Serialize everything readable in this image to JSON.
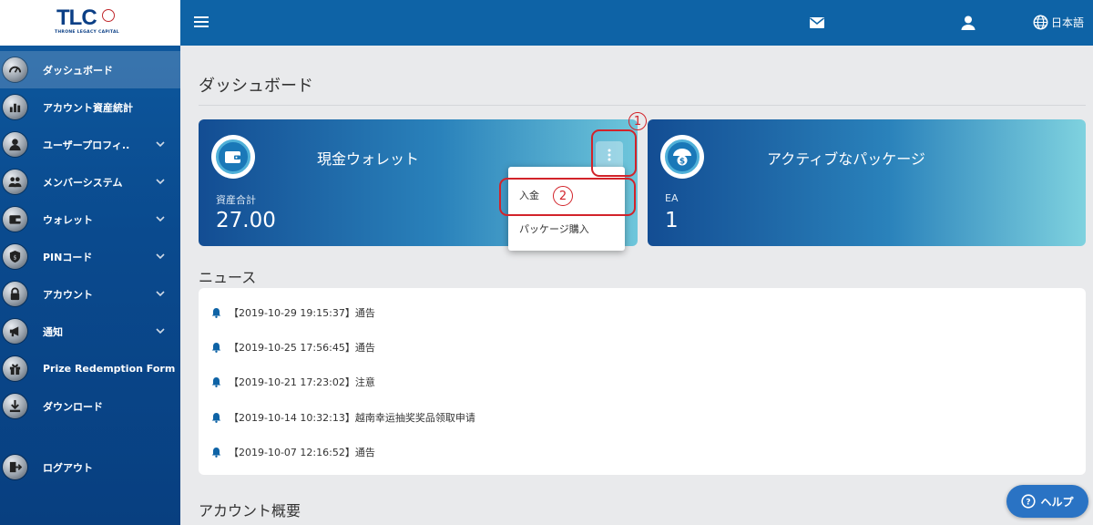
{
  "logo": {
    "text": "TLC",
    "sub": "THRONE LEGACY CAPITAL"
  },
  "sidebar": {
    "items": [
      {
        "label": "ダッシュボード",
        "icon": "dashboard-gauge-icon",
        "chevron": false
      },
      {
        "label": "アカウント資産統計",
        "icon": "bar-chart-icon",
        "chevron": false
      },
      {
        "label": "ユーザープロフィ..",
        "icon": "user-icon",
        "chevron": true
      },
      {
        "label": "メンバーシステム",
        "icon": "group-icon",
        "chevron": true
      },
      {
        "label": "ウォレット",
        "icon": "wallet-icon",
        "chevron": true
      },
      {
        "label": "PINコード",
        "icon": "pin-badge-icon",
        "chevron": true
      },
      {
        "label": "アカウント",
        "icon": "lock-icon",
        "chevron": true
      },
      {
        "label": "通知",
        "icon": "megaphone-icon",
        "chevron": true
      },
      {
        "label": "Prize Redemption Form",
        "icon": "gift-icon",
        "chevron": false
      },
      {
        "label": "ダウンロード",
        "icon": "download-icon",
        "chevron": false
      },
      {
        "label": "ログアウト",
        "icon": "logout-icon",
        "chevron": false
      }
    ]
  },
  "topbar": {
    "language": "日本語"
  },
  "page": {
    "title": "ダッシュボード"
  },
  "cards": {
    "wallet": {
      "title": "現金ウォレット",
      "sub": "資産合計",
      "value": "27.00"
    },
    "package": {
      "title": "アクティブなパッケージ",
      "sub": "EA",
      "value": "1"
    }
  },
  "dropdown": {
    "items": [
      "入金",
      "パッケージ購入"
    ]
  },
  "annotations": {
    "one": "1",
    "two": "2"
  },
  "news": {
    "title": "ニュース",
    "items": [
      "【2019-10-29 19:15:37】通告",
      "【2019-10-25 17:56:45】通告",
      "【2019-10-21 17:23:02】注意",
      "【2019-10-14 10:32:13】越南幸运抽奖奖品领取申请",
      "【2019-10-07 12:16:52】通告"
    ]
  },
  "summary": {
    "title": "アカウント概要"
  },
  "help": {
    "label": "ヘルプ"
  }
}
